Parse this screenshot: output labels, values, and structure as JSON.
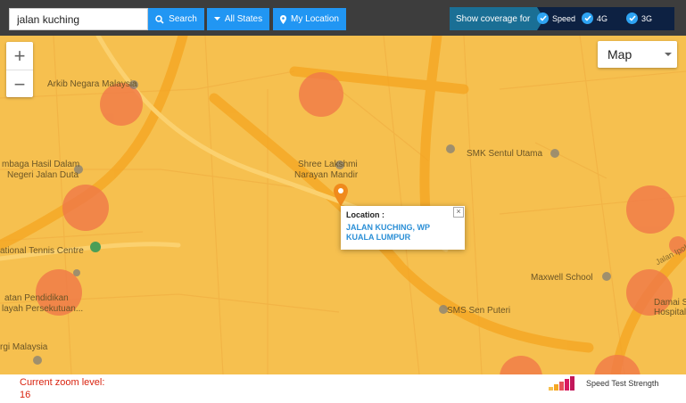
{
  "search": {
    "value": "jalan kuching"
  },
  "buttons": {
    "search": "Search",
    "states": "All States",
    "location": "My Location"
  },
  "coverage": {
    "label": "Show coverage for",
    "options": [
      {
        "label": "Speed",
        "checked": true
      },
      {
        "label": "4G",
        "checked": true
      },
      {
        "label": "3G",
        "checked": true
      }
    ]
  },
  "map_controls": {
    "zoom_in": "+",
    "zoom_out": "−",
    "type": "Map"
  },
  "popup": {
    "title": "Location :",
    "value": "JALAN KUCHING, WP KUALA LUMPUR",
    "close": "×"
  },
  "footer": {
    "zoom_label": "Current zoom level:",
    "zoom_value": "16",
    "legend": "Speed Test Strength"
  },
  "map_labels": {
    "arkib": "Arkib Negara Malaysia",
    "lembaga1": "mbaga Hasil Dalam",
    "lembaga2": "Negeri Jalan Duta",
    "shree1": "Shree Lakshmi",
    "shree2": "Narayan Mandir",
    "smk": "SMK Sentul Utama",
    "tennis": "ational Tennis Centre",
    "maxwell": "Maxwell School",
    "pend1": "atan Pendidikan",
    "pend2": "layah Persekutuan...",
    "sms": "SMS Sen Puteri",
    "jalanipoh": "Jalan Ipoh",
    "arkib2": "rgi Malaysia",
    "damai1": "Damai S",
    "damai2": "Hospital"
  },
  "colors": {
    "map_bg": "#f6c04f",
    "road": "#f7a92a",
    "hotspot": "#f07a48",
    "accent": "#2196f3",
    "coverage_bg": "#0d2142"
  }
}
